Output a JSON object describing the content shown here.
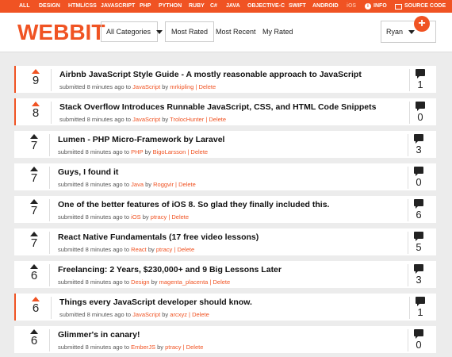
{
  "topbar": {
    "categories": [
      "ALL",
      "DESIGN",
      "HTML/CSS",
      "JAVASCRIPT",
      "PHP",
      "PYTHON",
      "RUBY",
      "C#",
      "JAVA",
      "OBJECTIVE-C",
      "SWIFT",
      "ANDROID",
      "iOS"
    ],
    "info_label": "INFO",
    "source_label": "SOURCE CODE"
  },
  "header": {
    "logo": "WEBBIT",
    "category_select": "All Categories",
    "tabs": [
      "Most Rated",
      "Most Recent",
      "My Rated"
    ],
    "user": "Ryan",
    "add_symbol": "+"
  },
  "posts": [
    {
      "score": "9",
      "title": "Airbnb JavaScript Style Guide - A mostly reasonable approach to JavaScript",
      "submitted": "submitted 8 minutes ago to",
      "category": "JavaScript",
      "by": "by",
      "author": "mrkipling",
      "sep": "|",
      "delete": "Delete",
      "comments": "1",
      "hot": true
    },
    {
      "score": "8",
      "title": "Stack Overflow Introduces Runnable JavaScript, CSS, and HTML Code Snippets",
      "submitted": "submitted 8 minutes ago to",
      "category": "JavaScript",
      "by": "by",
      "author": "TrolocHunter",
      "sep": "|",
      "delete": "Delete",
      "comments": "0",
      "hot": true
    },
    {
      "score": "7",
      "title": "Lumen - PHP Micro-Framework by Laravel",
      "submitted": "submitted 8 minutes ago to",
      "category": "PHP",
      "by": "by",
      "author": "BigoLarsson",
      "sep": "|",
      "delete": "Delete",
      "comments": "3",
      "hot": false
    },
    {
      "score": "7",
      "title": "Guys, I found it",
      "submitted": "submitted 8 minutes ago to",
      "category": "Java",
      "by": "by",
      "author": "Roggvir",
      "sep": "|",
      "delete": "Delete",
      "comments": "0",
      "hot": false
    },
    {
      "score": "7",
      "title": "One of the better features of iOS 8. So glad they finally included this.",
      "submitted": "submitted 8 minutes ago to",
      "category": "iOS",
      "by": "by",
      "author": "ptracy",
      "sep": "|",
      "delete": "Delete",
      "comments": "6",
      "hot": false
    },
    {
      "score": "7",
      "title": "React Native Fundamentals (17 free video lessons)",
      "submitted": "submitted 8 minutes ago to",
      "category": "React",
      "by": "by",
      "author": "ptracy",
      "sep": "|",
      "delete": "Delete",
      "comments": "5",
      "hot": false
    },
    {
      "score": "6",
      "title": "Freelancing: 2 Years, $230,000+ and 9 Big Lessons Later",
      "submitted": "submitted 8 minutes ago to",
      "category": "Design",
      "by": "by",
      "author": "magenta_placenta",
      "sep": "|",
      "delete": "Delete",
      "comments": "3",
      "hot": false
    },
    {
      "score": "6",
      "title": "Things every JavaScript developer should know.",
      "submitted": "submitted 8 minutes ago to",
      "category": "JavaScript",
      "by": "by",
      "author": "arcxyz",
      "sep": "|",
      "delete": "Delete",
      "comments": "1",
      "hot": true
    },
    {
      "score": "6",
      "title": "Glimmer's in canary!",
      "submitted": "submitted 8 minutes ago to",
      "category": "EmberJS",
      "by": "by",
      "author": "ptracy",
      "sep": "|",
      "delete": "Delete",
      "comments": "0",
      "hot": false
    }
  ],
  "colors": {
    "accent": "#f05323",
    "background": "#ececec"
  }
}
